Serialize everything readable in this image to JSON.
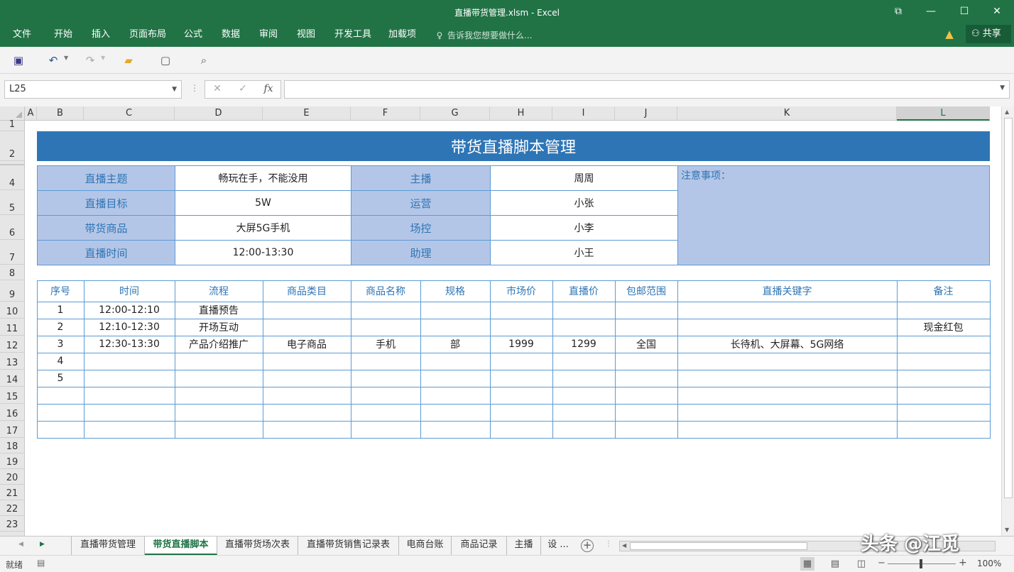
{
  "window": {
    "title": "直播带货管理.xlsm - Excel",
    "btn_ribbon": "⧉",
    "btn_min": "—",
    "btn_max": "☐",
    "btn_close": "✕"
  },
  "menu": {
    "items": [
      "文件",
      "开始",
      "插入",
      "页面布局",
      "公式",
      "数据",
      "审阅",
      "视图",
      "开发工具",
      "加载项"
    ],
    "tell_me": "告诉我您想要做什么...",
    "share": "共享",
    "warning_icon": "warning-icon"
  },
  "qat": {
    "icons": [
      "save-icon",
      "undo-icon",
      "redo-icon",
      "open-folder-icon",
      "new-file-icon",
      "print-preview-icon"
    ]
  },
  "formula_bar": {
    "name_box": "L25",
    "cancel": "✕",
    "enter": "✓",
    "fx": "fx",
    "content": ""
  },
  "columns": [
    "A",
    "B",
    "C",
    "D",
    "E",
    "F",
    "G",
    "H",
    "I",
    "J",
    "K",
    "L"
  ],
  "selected_column": "L",
  "rows": [
    "1",
    "2",
    "4",
    "5",
    "6",
    "7",
    "8",
    "9",
    "10",
    "11",
    "12",
    "13",
    "14",
    "15",
    "16",
    "17",
    "18",
    "19",
    "20",
    "21",
    "22",
    "23"
  ],
  "sheet": {
    "banner_title": "带货直播脚本管理",
    "info": {
      "labels_left": [
        "直播主题",
        "直播目标",
        "带货商品",
        "直播时间"
      ],
      "values_left": [
        "畅玩在手，不能没用",
        "5W",
        "大屏5G手机",
        "12:00-13:30"
      ],
      "labels_right": [
        "主播",
        "运营",
        "场控",
        "助理"
      ],
      "values_right": [
        "周周",
        "小张",
        "小李",
        "小王"
      ],
      "notes_label": "注意事项："
    },
    "table_headers": [
      "序号",
      "时间",
      "流程",
      "商品类目",
      "商品名称",
      "规格",
      "市场价",
      "直播价",
      "包邮范围",
      "直播关键字",
      "备注"
    ],
    "table_rows": [
      [
        "1",
        "12:00-12:10",
        "直播预告",
        "",
        "",
        "",
        "",
        "",
        "",
        "",
        ""
      ],
      [
        "2",
        "12:10-12:30",
        "开场互动",
        "",
        "",
        "",
        "",
        "",
        "",
        "",
        "现金红包"
      ],
      [
        "3",
        "12:30-13:30",
        "产品介绍推广",
        "电子商品",
        "手机",
        "部",
        "1999",
        "1299",
        "全国",
        "长待机、大屏幕、5G网络",
        ""
      ],
      [
        "4",
        "",
        "",
        "",
        "",
        "",
        "",
        "",
        "",
        "",
        ""
      ],
      [
        "5",
        "",
        "",
        "",
        "",
        "",
        "",
        "",
        "",
        "",
        ""
      ],
      [
        "",
        "",
        "",
        "",
        "",
        "",
        "",
        "",
        "",
        "",
        ""
      ],
      [
        "",
        "",
        "",
        "",
        "",
        "",
        "",
        "",
        "",
        "",
        ""
      ],
      [
        "",
        "",
        "",
        "",
        "",
        "",
        "",
        "",
        "",
        "",
        ""
      ]
    ]
  },
  "tabs": [
    "直播带货管理",
    "带货直播脚本",
    "直播带货场次表",
    "直播带货销售记录表",
    "电商台账",
    "商品记录",
    "主播",
    "设 ..."
  ],
  "active_tab": "带货直播脚本",
  "status": {
    "ready": "就绪",
    "zoom": "100%"
  },
  "watermark": "头条 @江觅"
}
